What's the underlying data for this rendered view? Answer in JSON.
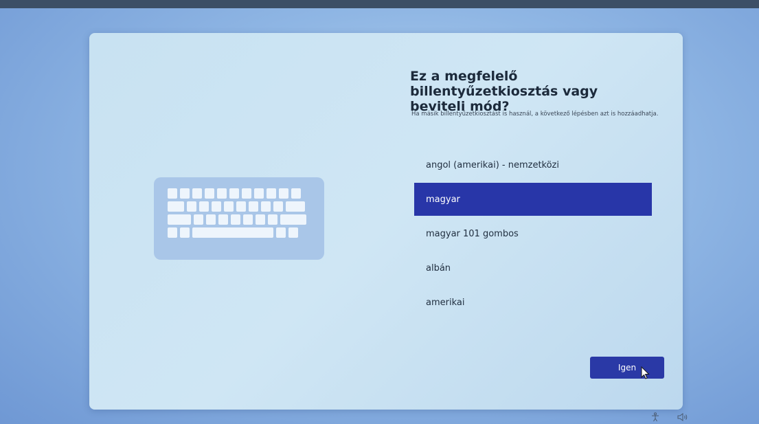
{
  "setup": {
    "title": "Ez a megfelelő billentyűzetkiosztás vagy beviteli mód?",
    "subtitle": "Ha másik billentyűzetkiosztást is használ, a következő lépésben azt is hozzáadhatja.",
    "layouts": [
      {
        "label": "angol (amerikai) - nemzetközi",
        "selected": false
      },
      {
        "label": "magyar",
        "selected": true
      },
      {
        "label": "magyar 101 gombos",
        "selected": false
      },
      {
        "label": "albán",
        "selected": false
      },
      {
        "label": "amerikai",
        "selected": false
      }
    ],
    "confirm_label": "Igen"
  },
  "icons": {
    "illustration": "keyboard-icon",
    "cursor": "mouse-pointer-icon",
    "tray": [
      "accessibility-icon",
      "volume-icon"
    ]
  },
  "colors": {
    "accent": "#2836a8",
    "panel": "#cde5f3",
    "keyboard": "#a9c6e8"
  }
}
